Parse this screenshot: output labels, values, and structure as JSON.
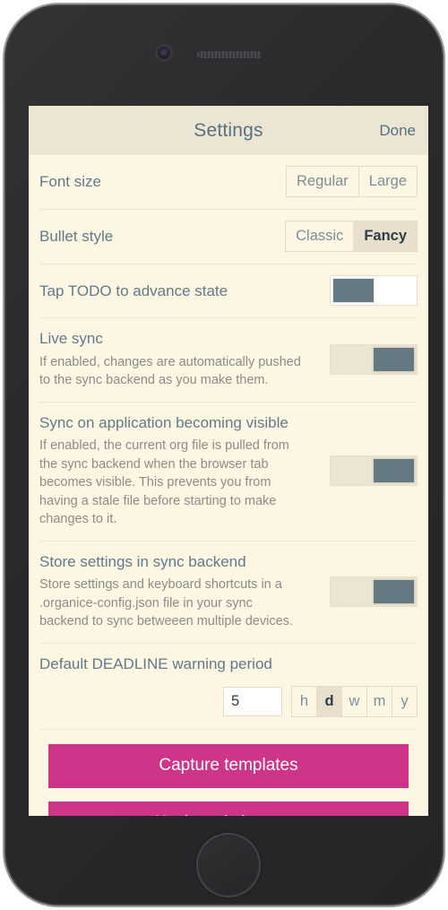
{
  "header": {
    "title": "Settings",
    "done_label": "Done"
  },
  "settings": {
    "font_size": {
      "title": "Font size",
      "options": [
        {
          "label": "Regular",
          "selected": false
        },
        {
          "label": "Large",
          "selected": false
        }
      ]
    },
    "bullet_style": {
      "title": "Bullet style",
      "options": [
        {
          "label": "Classic",
          "selected": false
        },
        {
          "label": "Fancy",
          "selected": true
        }
      ]
    },
    "tap_todo": {
      "title": "Tap TODO to advance state",
      "enabled": false
    },
    "live_sync": {
      "title": "Live sync",
      "description": "If enabled, changes are automatically pushed to the sync backend as you make them.",
      "enabled": true
    },
    "sync_on_visible": {
      "title": "Sync on application becoming visible",
      "description": "If enabled, the current org file is pulled from the sync backend when the browser tab becomes visible. This prevents you from having a stale file before starting to make changes to it.",
      "enabled": true
    },
    "store_settings": {
      "title": "Store settings in sync backend",
      "description": "Store settings and keyboard shortcuts in a .organice-config.json file in your sync backend to sync betweeen multiple devices.",
      "enabled": true
    },
    "deadline": {
      "title": "Default DEADLINE warning period",
      "value": "5",
      "placeholder": "",
      "units": [
        {
          "label": "h",
          "selected": false
        },
        {
          "label": "d",
          "selected": true
        },
        {
          "label": "w",
          "selected": false
        },
        {
          "label": "m",
          "selected": false
        },
        {
          "label": "y",
          "selected": false
        }
      ]
    }
  },
  "actions": {
    "capture_templates": "Capture templates",
    "keyboard_shortcuts": "Keyboard shortcuts"
  },
  "device": {
    "camera_icon": "camera-icon",
    "speaker_icon": "speaker-grille-icon",
    "home_button": "home-button"
  },
  "colors": {
    "accent": "#ce3588",
    "screen_bg": "#fdf6e3",
    "header_bg": "#ece5d3",
    "title_text": "#63798a",
    "toggle_thumb": "#647981"
  }
}
